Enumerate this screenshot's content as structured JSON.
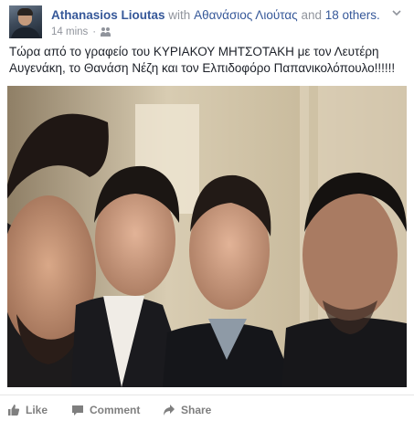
{
  "post": {
    "author": "Athanasios Lioutas",
    "with_prefix": "with",
    "tagged_name": "Αθανάσιος Λιούτας",
    "and_text": "and",
    "others": "18 others.",
    "timestamp": "14 mins",
    "separator": "·",
    "audience_icon": "friends-icon",
    "menu_icon": "chevron-down-icon",
    "text": "Τώρα από το γραφείο του ΚΥΡΙΑΚΟΥ ΜΗΤΣΟΤΑΚΗ με τον Λευτέρη Αυγενάκη, το Θανάση Νέζη και τον Ελπιδοφόρο Παπανικολόπουλο!!!!!!"
  },
  "actions": {
    "like": "Like",
    "comment": "Comment",
    "share": "Share"
  },
  "colors": {
    "link": "#365899",
    "muted": "#90949c",
    "action": "#7f7f7f"
  }
}
